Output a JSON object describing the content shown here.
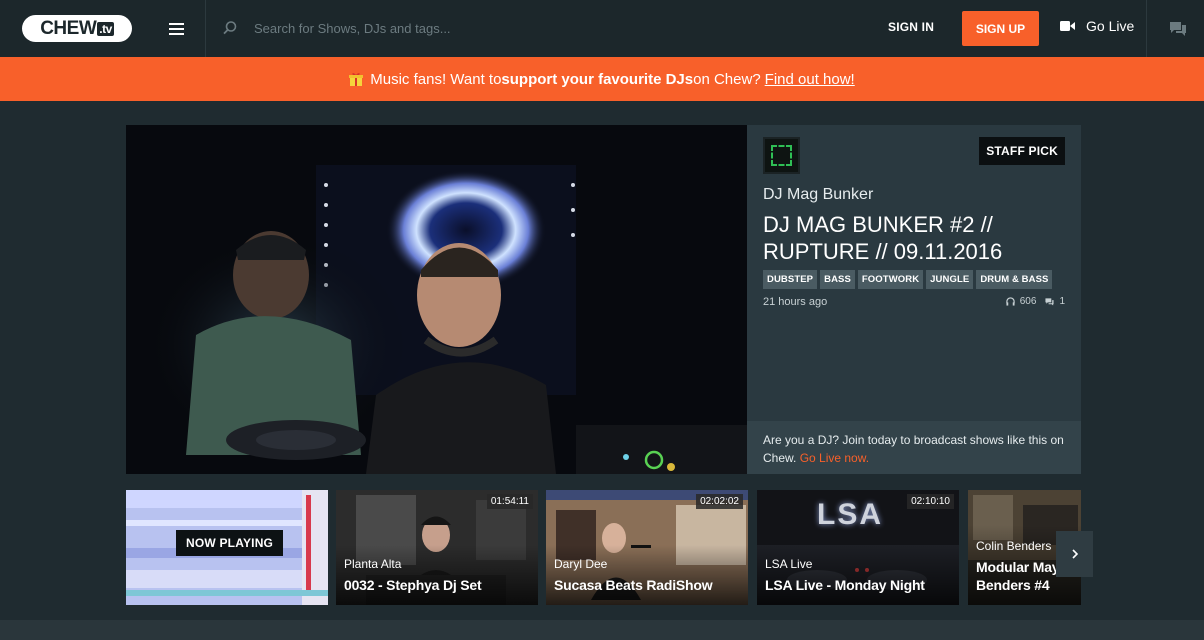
{
  "header": {
    "logo_main": "CHEW",
    "logo_tv": ".tv",
    "search_placeholder": "Search for Shows, DJs and tags...",
    "sign_in": "SIGN IN",
    "sign_up": "SIGN UP",
    "go_live": "Go Live"
  },
  "banner": {
    "text_start": "Music fans! Want to ",
    "text_bold": "support your favourite DJs",
    "text_end": " on Chew?",
    "link": "Find out how!"
  },
  "featured": {
    "badge": "STAFF PICK",
    "dj": "DJ Mag Bunker",
    "title": "DJ MAG BUNKER #2 // RUPTURE // 09.11.2016",
    "tags": [
      "DUBSTEP",
      "BASS",
      "FOOTWORK",
      "JUNGLE",
      "DRUM & BASS"
    ],
    "time_ago": "21 hours ago",
    "listens": "606",
    "comments": "1",
    "cta_text": "Are you a DJ? Join today to broadcast shows like this on Chew. ",
    "cta_link": "Go Live now."
  },
  "thumbnails": [
    {
      "now_playing": "NOW PLAYING"
    },
    {
      "duration": "01:54:11",
      "dj": "Planta Alta",
      "title": "0032 - Stephya Dj Set"
    },
    {
      "duration": "02:02:02",
      "dj": "Daryl Dee",
      "title": "Sucasa Beats RadiShow"
    },
    {
      "duration": "02:10:10",
      "dj": "LSA Live",
      "title": "LSA Live - Monday Night",
      "overlay_text": "LSA"
    },
    {
      "dj": "Colin Benders",
      "title_line1": "Modular Mayhem",
      "title_line2": "Benders #4"
    }
  ],
  "colors": {
    "accent": "#f8602a",
    "header_bg": "#1c272b",
    "page_bg": "#1f2b30",
    "panel_bg": "#2a3940"
  }
}
